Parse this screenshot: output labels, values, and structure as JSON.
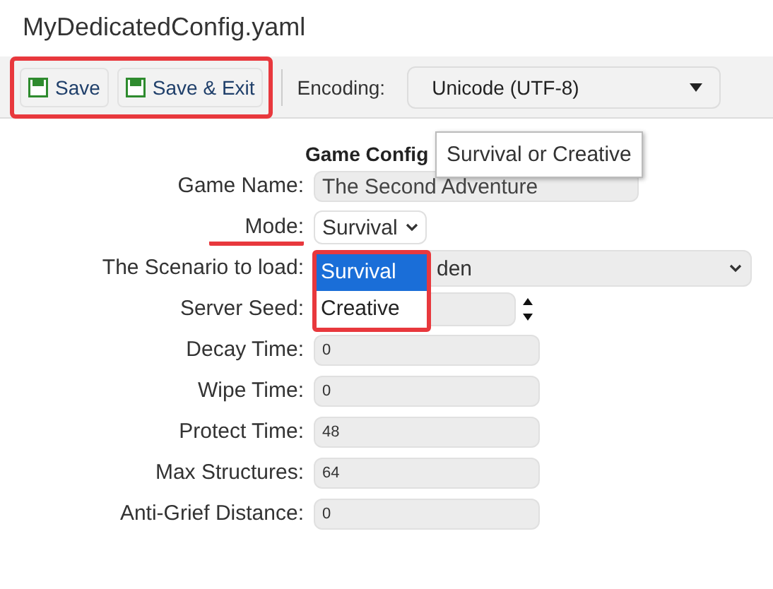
{
  "window": {
    "title": "MyDedicatedConfig.yaml"
  },
  "toolbar": {
    "highlighted": true,
    "buttons": [
      {
        "label": "Save"
      },
      {
        "label": "Save & Exit"
      }
    ],
    "encoding": {
      "label": "Encoding:",
      "value": "Unicode (UTF-8)"
    }
  },
  "form": {
    "heading": "Game Config",
    "fields": [
      {
        "label": "Game Name:",
        "kind": "text",
        "value": "The Second Adventure",
        "underlined": false
      },
      {
        "label": "Mode:",
        "kind": "select",
        "value": "Survival",
        "underlined": true
      },
      {
        "label": "The Scenario to load:",
        "kind": "wide-select",
        "value": "den",
        "underlined": false
      },
      {
        "label": "Server Seed:",
        "kind": "number",
        "underlined": false
      },
      {
        "label": "Decay Time:",
        "kind": "small",
        "value": "0",
        "underlined": false
      },
      {
        "label": "Wipe Time:",
        "kind": "small",
        "value": "0",
        "underlined": false
      },
      {
        "label": "Protect Time:",
        "kind": "small",
        "value": "48",
        "underlined": false
      },
      {
        "label": "Max Structures:",
        "kind": "small",
        "value": "64",
        "underlined": false
      },
      {
        "label": "Anti-Grief Distance:",
        "kind": "small",
        "value": "0",
        "underlined": false
      }
    ]
  },
  "tooltip": {
    "text": "Survival or Creative"
  },
  "dropdown": {
    "highlighted": true,
    "options": [
      {
        "label": "Survival",
        "selected": true
      },
      {
        "label": "Creative",
        "selected": false
      }
    ]
  }
}
